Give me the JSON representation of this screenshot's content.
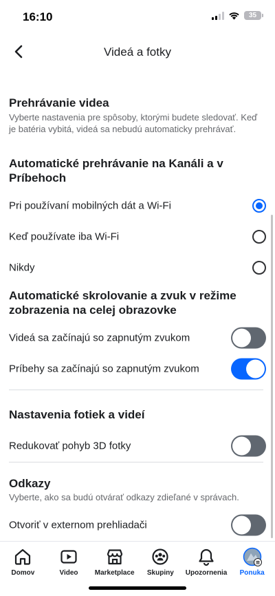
{
  "status_bar": {
    "time": "16:10",
    "battery": "35"
  },
  "header": {
    "title": "Videá a fotky",
    "back_icon": "chevron-left-icon"
  },
  "video_playback": {
    "title": "Prehrávanie videa",
    "description": "Vyberte nastavenia pre spôsoby, ktorými budete sledovať. Keď je batéria vybitá, videá sa nebudú automaticky prehrávať."
  },
  "autoplay": {
    "title": "Automatické prehrávanie na Kanáli a v Príbehoch",
    "options": [
      {
        "label": "Pri používaní mobilných dát a Wi-Fi",
        "selected": true
      },
      {
        "label": "Keď používate iba Wi-Fi",
        "selected": false
      },
      {
        "label": "Nikdy",
        "selected": false
      }
    ]
  },
  "fullscreen": {
    "title": "Automatické skrolovanie a zvuk v režime zobrazenia na celej obrazovke",
    "toggles": [
      {
        "label": "Videá sa začínajú so zapnutým zvukom",
        "on": false
      },
      {
        "label": "Príbehy sa začínajú so zapnutým zvukom",
        "on": true
      }
    ]
  },
  "photo_settings": {
    "title": "Nastavenia fotiek a videí",
    "toggles": [
      {
        "label": "Redukovať pohyb 3D fotky",
        "on": false
      }
    ]
  },
  "links": {
    "title": "Odkazy",
    "description": "Vyberte, ako sa budú otvárať odkazy zdieľané v správach.",
    "toggles": [
      {
        "label": "Otvoriť v externom prehliadači",
        "on": false
      }
    ]
  },
  "tabbar": {
    "items": [
      {
        "label": "Domov",
        "icon": "home-icon"
      },
      {
        "label": "Video",
        "icon": "video-icon"
      },
      {
        "label": "Marketplace",
        "icon": "marketplace-icon"
      },
      {
        "label": "Skupiny",
        "icon": "groups-icon"
      },
      {
        "label": "Upozornenia",
        "icon": "bell-icon"
      },
      {
        "label": "Ponuka",
        "icon": "menu-avatar-icon",
        "active": true
      }
    ]
  },
  "colors": {
    "accent": "#0866ff",
    "toggle_off": "#606770",
    "text": "#1c1e21",
    "secondary_text": "#65676b"
  }
}
